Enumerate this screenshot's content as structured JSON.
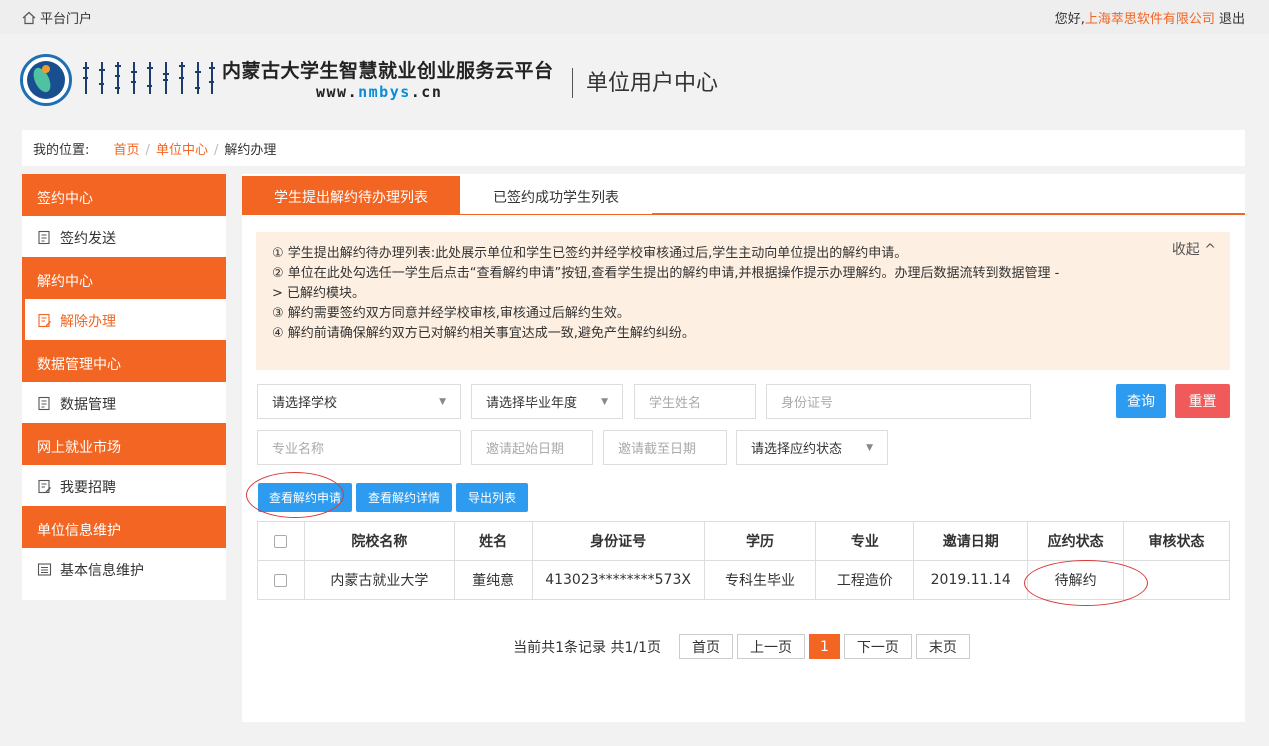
{
  "topbar": {
    "portal_label": "平台门户",
    "greeting": "您好,",
    "company": "上海萃思软件有限公司",
    "logout": "退出"
  },
  "header": {
    "platform_title": "内蒙古大学生智慧就业创业服务云平台",
    "url_prefix": "www.",
    "url_accent": "nmbys",
    "url_suffix": ".cn",
    "center_title": "单位用户中心"
  },
  "breadcrumb": {
    "label": "我的位置:",
    "items": [
      "首页",
      "单位中心",
      "解约办理"
    ]
  },
  "sidebar": {
    "sections": [
      {
        "title": "签约中心",
        "items": [
          "签约发送"
        ]
      },
      {
        "title": "解约中心",
        "items": [
          "解除办理"
        ]
      },
      {
        "title": "数据管理中心",
        "items": [
          "数据管理"
        ]
      },
      {
        "title": "网上就业市场",
        "items": [
          "我要招聘"
        ]
      },
      {
        "title": "单位信息维护",
        "items": [
          "基本信息维护"
        ]
      }
    ]
  },
  "tabs": [
    "学生提出解约待办理列表",
    "已签约成功学生列表"
  ],
  "notice": {
    "collapse": "收起 ^",
    "lines": [
      "① 学生提出解约待办理列表:此处展示单位和学生已签约并经学校审核通过后,学生主动向单位提出的解约申请。",
      "② 单位在此处勾选任一学生后点击“查看解约申请”按钮,查看学生提出的解约申请,并根据操作提示办理解约。办理后数据流转到数据管理 -",
      "> 已解约模块。",
      "③ 解约需要签约双方同意并经学校审核,审核通过后解约生效。",
      "④ 解约前请确保解约双方已对解约相关事宜达成一致,避免产生解约纠纷。"
    ]
  },
  "filters": {
    "school": "请选择学校",
    "year": "请选择毕业年度",
    "student_name": "学生姓名",
    "id_number": "身份证号",
    "major": "专业名称",
    "start_date": "邀请起始日期",
    "end_date": "邀请截至日期",
    "status": "请选择应约状态",
    "query": "查询",
    "reset": "重置"
  },
  "actions": [
    "查看解约申请",
    "查看解约详情",
    "导出列表"
  ],
  "table": {
    "headers": [
      "院校名称",
      "姓名",
      "身份证号",
      "学历",
      "专业",
      "邀请日期",
      "应约状态",
      "审核状态"
    ],
    "rows": [
      [
        "内蒙古就业大学",
        "董纯意",
        "413023********573X",
        "专科生毕业",
        "工程造价",
        "2019.11.14",
        "待解约",
        ""
      ]
    ]
  },
  "pager": {
    "info": "当前共1条记录  共1/1页",
    "first": "首页",
    "prev": "上一页",
    "current": "1",
    "next": "下一页",
    "last": "末页"
  },
  "colors": {
    "accent": "#f26522",
    "button_blue": "#2d9cf0",
    "button_red": "#f05a5a"
  }
}
